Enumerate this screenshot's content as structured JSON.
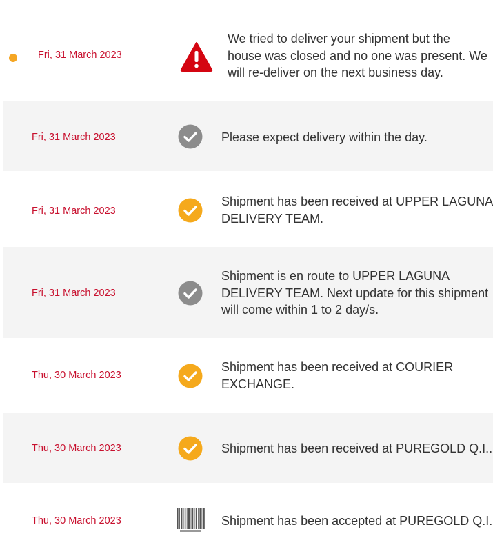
{
  "colors": {
    "date": "#c8102e",
    "text": "#333333",
    "shaded_row": "#f4f4f4",
    "warning_red": "#d40511",
    "check_gray": "#8c8c8c",
    "check_orange": "#f5a91c",
    "current_dot": "#f5a623"
  },
  "events": [
    {
      "date": "Fri, 31 March 2023",
      "icon": "warning-icon",
      "current": true,
      "message_lines": [
        "We tried to deliver your shipment but the",
        "house was closed and no one was present. We",
        "will re-deliver on the next business day."
      ]
    },
    {
      "date": "Fri, 31 March 2023",
      "icon": "check-circle-gray-icon",
      "message_lines": [
        "Please expect delivery within the day."
      ]
    },
    {
      "date": "Fri, 31 March 2023",
      "icon": "check-circle-orange-icon",
      "message_lines": [
        "Shipment has been received at UPPER LAGUNA",
        "DELIVERY TEAM."
      ]
    },
    {
      "date": "Fri, 31 March 2023",
      "icon": "check-circle-gray-icon",
      "message_lines": [
        "Shipment is en route to UPPER LAGUNA",
        "DELIVERY TEAM. Next update for this shipment",
        "will come within 1 to 2 day/s."
      ]
    },
    {
      "date": "Thu, 30 March 2023",
      "icon": "check-circle-orange-icon",
      "message_lines": [
        "Shipment has been received at COURIER",
        "EXCHANGE."
      ]
    },
    {
      "date": "Thu, 30 March 2023",
      "icon": "check-circle-orange-icon",
      "message_lines": [
        "Shipment has been received at PUREGOLD Q.I.."
      ]
    },
    {
      "date": "Thu, 30 March 2023",
      "icon": "barcode-icon",
      "message_lines": [
        "Shipment has been accepted at PUREGOLD Q.I.."
      ]
    }
  ]
}
